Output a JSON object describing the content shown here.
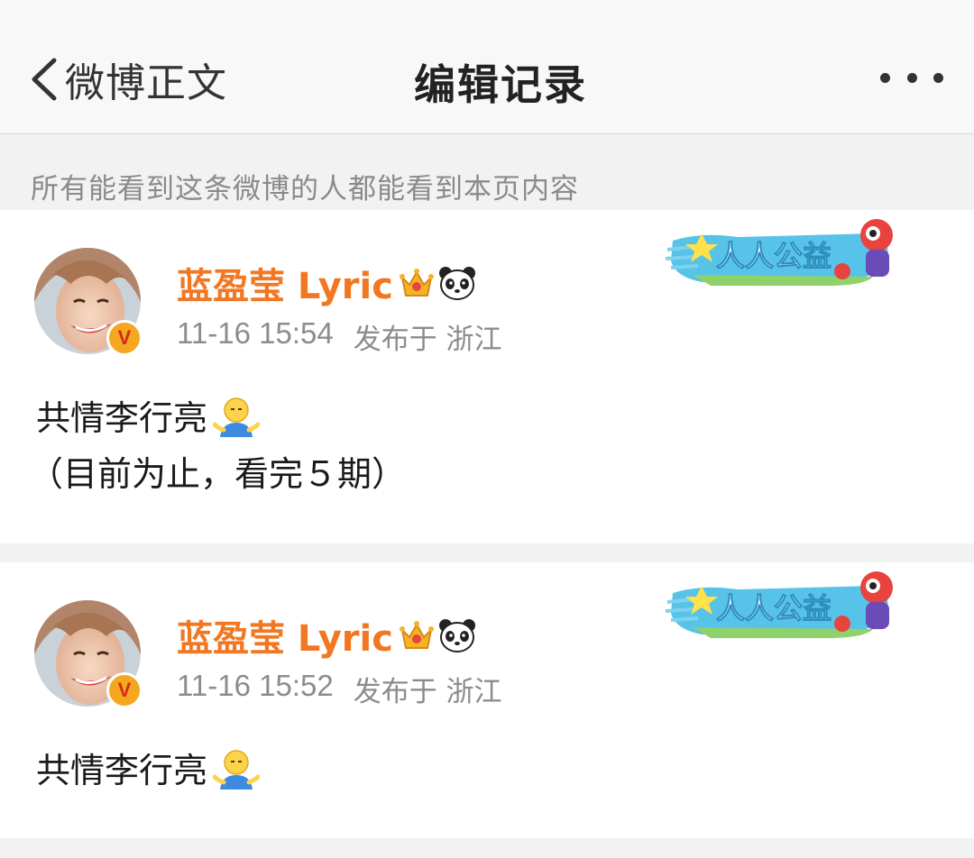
{
  "nav": {
    "back_label": "微博正文",
    "title": "编辑记录"
  },
  "notice": "所有能看到这条微博的人都能看到本页内容",
  "badge": {
    "label": "人人公益"
  },
  "posts": [
    {
      "username": "蓝盈莹 Lyric",
      "time": "11-16 15:54",
      "location": "发布于 浙江",
      "line1": "共情李行亮",
      "line2": "（目前为止，看完５期）"
    },
    {
      "username": "蓝盈莹 Lyric",
      "time": "11-16 15:52",
      "location": "发布于 浙江",
      "line1": "共情李行亮"
    }
  ],
  "colors": {
    "username": "#f27722",
    "meta": "#8c8c8c",
    "background": "#f2f2f2"
  },
  "icons": [
    "back-chevron-icon",
    "more-dots-icon",
    "verified-v-icon",
    "crown-icon",
    "panda-icon",
    "gongyi-badge-icon",
    "shrug-emoji-icon"
  ]
}
